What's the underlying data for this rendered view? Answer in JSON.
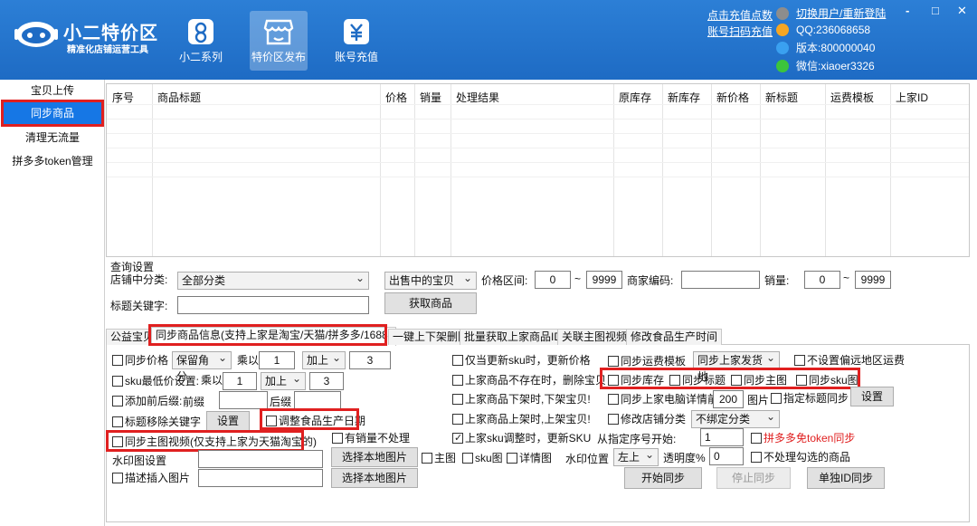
{
  "header": {
    "brand_title": "小二特价区",
    "brand_sub": "精准化店铺运营工具",
    "nav": [
      {
        "label": "小二系列",
        "icon": "person-icon"
      },
      {
        "label": "特价区发布",
        "icon": "store-icon"
      },
      {
        "label": "账号充值",
        "icon": "yen-icon"
      }
    ],
    "links": {
      "recharge": "点击充值点数",
      "switch_user": "切换用户/重新登陆",
      "scan_recharge": "账号扫码充值"
    },
    "info": {
      "qq": "QQ:236068658",
      "version": "版本:800000040",
      "wechat": "微信:xiaoer3326"
    },
    "window_controls": {
      "minimize": "-",
      "maximize": "□",
      "close": "✕"
    }
  },
  "sidebar": {
    "items": [
      "宝贝上传",
      "同步商品",
      "清理无流量",
      "拼多多token管理"
    ]
  },
  "table": {
    "columns": [
      "序号",
      "商品标题",
      "价格",
      "销量",
      "处理结果",
      "原库存",
      "新库存",
      "新价格",
      "新标题",
      "运费模板",
      "上家ID"
    ]
  },
  "query": {
    "section_title": "查询设置",
    "category_label": "店铺中分类:",
    "category_value": "全部分类",
    "status_value": "出售中的宝贝",
    "price_label": "价格区间:",
    "price_min": "0",
    "price_tilde": "~",
    "price_max": "9999",
    "merchant_code_label": "商家编码:",
    "merchant_code_value": "",
    "sales_label": "销量:",
    "sales_min": "0",
    "sales_tilde": "~",
    "sales_max": "9999",
    "keyword_label": "标题关键字:",
    "keyword_value": "",
    "fetch_button": "获取商品"
  },
  "tabs": [
    "公益宝贝",
    "同步商品信息(支持上家是淘宝/天猫/拼多多/1688)",
    "一键上下架删除",
    "批量获取上家商品ID",
    "关联主图视频",
    "修改食品生产时间"
  ],
  "sync": {
    "sync_price": "同步价格",
    "rounding_value": "保留角分",
    "multiply_label": "乘以",
    "multiply_value": "1",
    "plus_value": "加上",
    "plus_amount": "3",
    "sku_min_price": "sku最低价设置:",
    "sku_multiply_label": "乘以",
    "sku_multiply_value": "1",
    "sku_plus_value": "加上",
    "sku_plus_amount": "3",
    "add_prefix_suffix": "添加前后缀:",
    "prefix_label": "前缀",
    "prefix_value": "",
    "suffix_label": "后缀",
    "suffix_value": "",
    "remove_keywords": "标题移除关键字",
    "settings_button": "设置",
    "adjust_food_date": "调整食品生产日期",
    "sync_main_video": "同步主图视频(仅支持上家为天猫淘宝的)",
    "no_sales_skip": "有销量不处理",
    "watermark_label": "水印图设置",
    "watermark_value": "",
    "choose_local_image": "选择本地图片",
    "main_image": "主图",
    "sku_image": "sku图",
    "detail_image": "详情图",
    "watermark_position_label": "水印位置",
    "watermark_position_value": "左上",
    "opacity_label": "透明度%",
    "opacity_value": "0",
    "skip_checked_items": "不处理勾选的商品",
    "desc_insert_image": "描述插入图片",
    "desc_image_value": "",
    "choose_local_image_2": "选择本地图片",
    "only_update_sku_price": "仅当更新sku时，更新价格",
    "delete_if_missing": "上家商品不存在时，删除宝贝",
    "delist_if_supplier_delist": "上家商品下架时,下架宝贝!",
    "list_if_supplier_list": "上家商品上架时,上架宝贝!",
    "update_sku_on_change": "上家sku调整时，更新SKU",
    "sync_shipping_template": "同步运费模板",
    "shipping_template_value": "同步上家发货地",
    "no_remote_shipping": "不设置偏远地区运费",
    "sync_stock": "同步库存",
    "sync_title": "同步标题",
    "sync_main_image": "同步主图",
    "sync_sku_image": "同步sku图",
    "sync_pc_detail_prefix": "同步上家电脑详情前",
    "pc_detail_count": "200",
    "pc_detail_suffix": "图片",
    "specify_title_sync": "指定标题同步",
    "settings_button_2": "设置",
    "modify_shop_category": "修改店铺分类",
    "shop_category_value": "不绑定分类",
    "start_from_label": "从指定序号开始:",
    "start_from_value": "1",
    "pdd_token_sync": "拼多多免token同步",
    "start_sync": "开始同步",
    "stop_sync": "停止同步",
    "single_id_sync": "单独ID同步"
  }
}
